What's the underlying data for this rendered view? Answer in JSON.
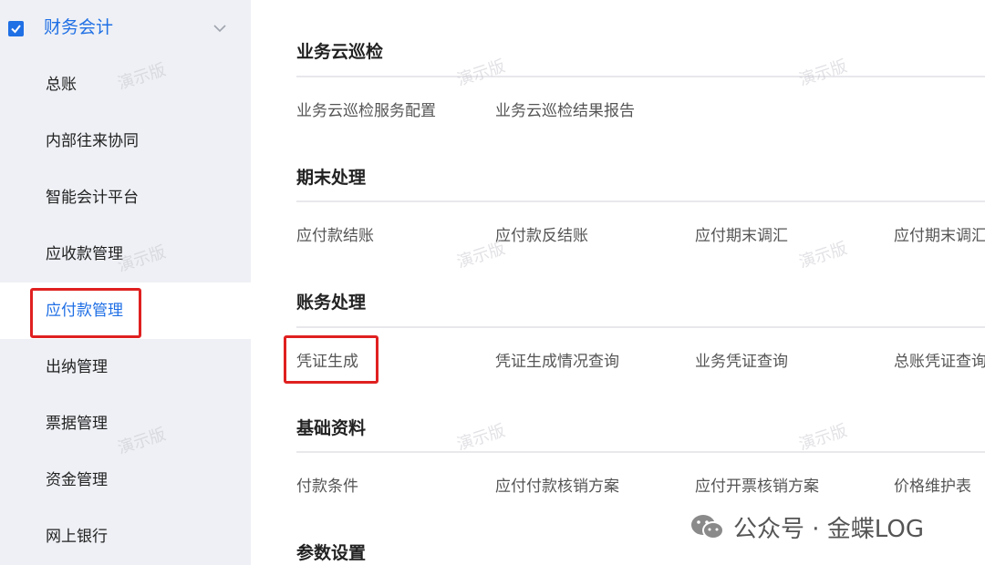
{
  "sidebar": {
    "header": {
      "title": "财务会计",
      "icon": "ledger-check-icon"
    },
    "items": [
      {
        "label": "总账"
      },
      {
        "label": "内部往来协同"
      },
      {
        "label": "智能会计平台"
      },
      {
        "label": "应收款管理"
      },
      {
        "label": "应付款管理",
        "active": true
      },
      {
        "label": "出纳管理"
      },
      {
        "label": "票据管理"
      },
      {
        "label": "资金管理"
      },
      {
        "label": "网上银行"
      }
    ]
  },
  "main": {
    "sections": [
      {
        "title": "业务云巡检",
        "links": [
          "业务云巡检服务配置",
          "业务云巡检结果报告"
        ]
      },
      {
        "title": "期末处理",
        "links": [
          "应付款结账",
          "应付款反结账",
          "应付期末调汇",
          "应付期末调汇"
        ]
      },
      {
        "title": "账务处理",
        "links": [
          "凭证生成",
          "凭证生成情况查询",
          "业务凭证查询",
          "总账凭证查询"
        ]
      },
      {
        "title": "基础资料",
        "links": [
          "付款条件",
          "应付付款核销方案",
          "应付开票核销方案",
          "价格维护表"
        ]
      },
      {
        "title": "参数设置",
        "links": []
      }
    ]
  },
  "watermark": {
    "text": "演示版"
  },
  "wechat_badge": {
    "text": "公众号 · 金蝶LOG",
    "icon": "wechat-icon"
  },
  "colors": {
    "accent": "#1f6fe5",
    "highlight_box": "#e02020",
    "sidebar_bg": "#eef0f5"
  }
}
